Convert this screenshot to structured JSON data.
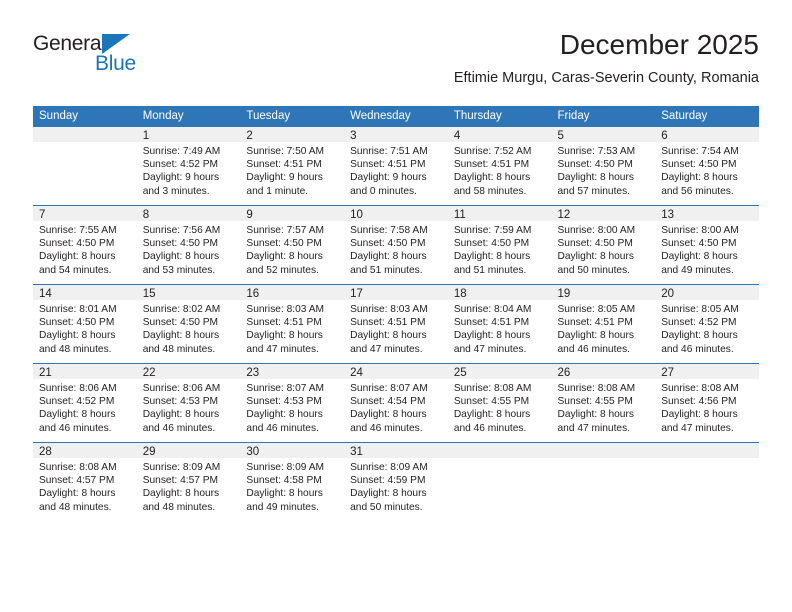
{
  "logo": {
    "word_one": "General",
    "word_two": "Blue",
    "triangle_color": "#1b75bb",
    "text_color": "#231f20"
  },
  "header": {
    "title": "December 2025",
    "subtitle": "Eftimie Murgu, Caras-Severin County, Romania"
  },
  "theme": {
    "header_blue": "#2e76b8",
    "daynum_background": "#f0f0f0",
    "text": "#231f20"
  },
  "calendar": {
    "weekday_headers": [
      "Sunday",
      "Monday",
      "Tuesday",
      "Wednesday",
      "Thursday",
      "Friday",
      "Saturday"
    ],
    "weeks": [
      [
        {
          "day": "",
          "empty": true
        },
        {
          "day": "1",
          "sunrise": "Sunrise: 7:49 AM",
          "sunset": "Sunset: 4:52 PM",
          "daylight": "Daylight: 9 hours and 3 minutes."
        },
        {
          "day": "2",
          "sunrise": "Sunrise: 7:50 AM",
          "sunset": "Sunset: 4:51 PM",
          "daylight": "Daylight: 9 hours and 1 minute."
        },
        {
          "day": "3",
          "sunrise": "Sunrise: 7:51 AM",
          "sunset": "Sunset: 4:51 PM",
          "daylight": "Daylight: 9 hours and 0 minutes."
        },
        {
          "day": "4",
          "sunrise": "Sunrise: 7:52 AM",
          "sunset": "Sunset: 4:51 PM",
          "daylight": "Daylight: 8 hours and 58 minutes."
        },
        {
          "day": "5",
          "sunrise": "Sunrise: 7:53 AM",
          "sunset": "Sunset: 4:50 PM",
          "daylight": "Daylight: 8 hours and 57 minutes."
        },
        {
          "day": "6",
          "sunrise": "Sunrise: 7:54 AM",
          "sunset": "Sunset: 4:50 PM",
          "daylight": "Daylight: 8 hours and 56 minutes."
        }
      ],
      [
        {
          "day": "7",
          "sunrise": "Sunrise: 7:55 AM",
          "sunset": "Sunset: 4:50 PM",
          "daylight": "Daylight: 8 hours and 54 minutes."
        },
        {
          "day": "8",
          "sunrise": "Sunrise: 7:56 AM",
          "sunset": "Sunset: 4:50 PM",
          "daylight": "Daylight: 8 hours and 53 minutes."
        },
        {
          "day": "9",
          "sunrise": "Sunrise: 7:57 AM",
          "sunset": "Sunset: 4:50 PM",
          "daylight": "Daylight: 8 hours and 52 minutes."
        },
        {
          "day": "10",
          "sunrise": "Sunrise: 7:58 AM",
          "sunset": "Sunset: 4:50 PM",
          "daylight": "Daylight: 8 hours and 51 minutes."
        },
        {
          "day": "11",
          "sunrise": "Sunrise: 7:59 AM",
          "sunset": "Sunset: 4:50 PM",
          "daylight": "Daylight: 8 hours and 51 minutes."
        },
        {
          "day": "12",
          "sunrise": "Sunrise: 8:00 AM",
          "sunset": "Sunset: 4:50 PM",
          "daylight": "Daylight: 8 hours and 50 minutes."
        },
        {
          "day": "13",
          "sunrise": "Sunrise: 8:00 AM",
          "sunset": "Sunset: 4:50 PM",
          "daylight": "Daylight: 8 hours and 49 minutes."
        }
      ],
      [
        {
          "day": "14",
          "sunrise": "Sunrise: 8:01 AM",
          "sunset": "Sunset: 4:50 PM",
          "daylight": "Daylight: 8 hours and 48 minutes."
        },
        {
          "day": "15",
          "sunrise": "Sunrise: 8:02 AM",
          "sunset": "Sunset: 4:50 PM",
          "daylight": "Daylight: 8 hours and 48 minutes."
        },
        {
          "day": "16",
          "sunrise": "Sunrise: 8:03 AM",
          "sunset": "Sunset: 4:51 PM",
          "daylight": "Daylight: 8 hours and 47 minutes."
        },
        {
          "day": "17",
          "sunrise": "Sunrise: 8:03 AM",
          "sunset": "Sunset: 4:51 PM",
          "daylight": "Daylight: 8 hours and 47 minutes."
        },
        {
          "day": "18",
          "sunrise": "Sunrise: 8:04 AM",
          "sunset": "Sunset: 4:51 PM",
          "daylight": "Daylight: 8 hours and 47 minutes."
        },
        {
          "day": "19",
          "sunrise": "Sunrise: 8:05 AM",
          "sunset": "Sunset: 4:51 PM",
          "daylight": "Daylight: 8 hours and 46 minutes."
        },
        {
          "day": "20",
          "sunrise": "Sunrise: 8:05 AM",
          "sunset": "Sunset: 4:52 PM",
          "daylight": "Daylight: 8 hours and 46 minutes."
        }
      ],
      [
        {
          "day": "21",
          "sunrise": "Sunrise: 8:06 AM",
          "sunset": "Sunset: 4:52 PM",
          "daylight": "Daylight: 8 hours and 46 minutes."
        },
        {
          "day": "22",
          "sunrise": "Sunrise: 8:06 AM",
          "sunset": "Sunset: 4:53 PM",
          "daylight": "Daylight: 8 hours and 46 minutes."
        },
        {
          "day": "23",
          "sunrise": "Sunrise: 8:07 AM",
          "sunset": "Sunset: 4:53 PM",
          "daylight": "Daylight: 8 hours and 46 minutes."
        },
        {
          "day": "24",
          "sunrise": "Sunrise: 8:07 AM",
          "sunset": "Sunset: 4:54 PM",
          "daylight": "Daylight: 8 hours and 46 minutes."
        },
        {
          "day": "25",
          "sunrise": "Sunrise: 8:08 AM",
          "sunset": "Sunset: 4:55 PM",
          "daylight": "Daylight: 8 hours and 46 minutes."
        },
        {
          "day": "26",
          "sunrise": "Sunrise: 8:08 AM",
          "sunset": "Sunset: 4:55 PM",
          "daylight": "Daylight: 8 hours and 47 minutes."
        },
        {
          "day": "27",
          "sunrise": "Sunrise: 8:08 AM",
          "sunset": "Sunset: 4:56 PM",
          "daylight": "Daylight: 8 hours and 47 minutes."
        }
      ],
      [
        {
          "day": "28",
          "sunrise": "Sunrise: 8:08 AM",
          "sunset": "Sunset: 4:57 PM",
          "daylight": "Daylight: 8 hours and 48 minutes."
        },
        {
          "day": "29",
          "sunrise": "Sunrise: 8:09 AM",
          "sunset": "Sunset: 4:57 PM",
          "daylight": "Daylight: 8 hours and 48 minutes."
        },
        {
          "day": "30",
          "sunrise": "Sunrise: 8:09 AM",
          "sunset": "Sunset: 4:58 PM",
          "daylight": "Daylight: 8 hours and 49 minutes."
        },
        {
          "day": "31",
          "sunrise": "Sunrise: 8:09 AM",
          "sunset": "Sunset: 4:59 PM",
          "daylight": "Daylight: 8 hours and 50 minutes."
        },
        {
          "day": "",
          "empty": true
        },
        {
          "day": "",
          "empty": true
        },
        {
          "day": "",
          "empty": true
        }
      ]
    ]
  }
}
